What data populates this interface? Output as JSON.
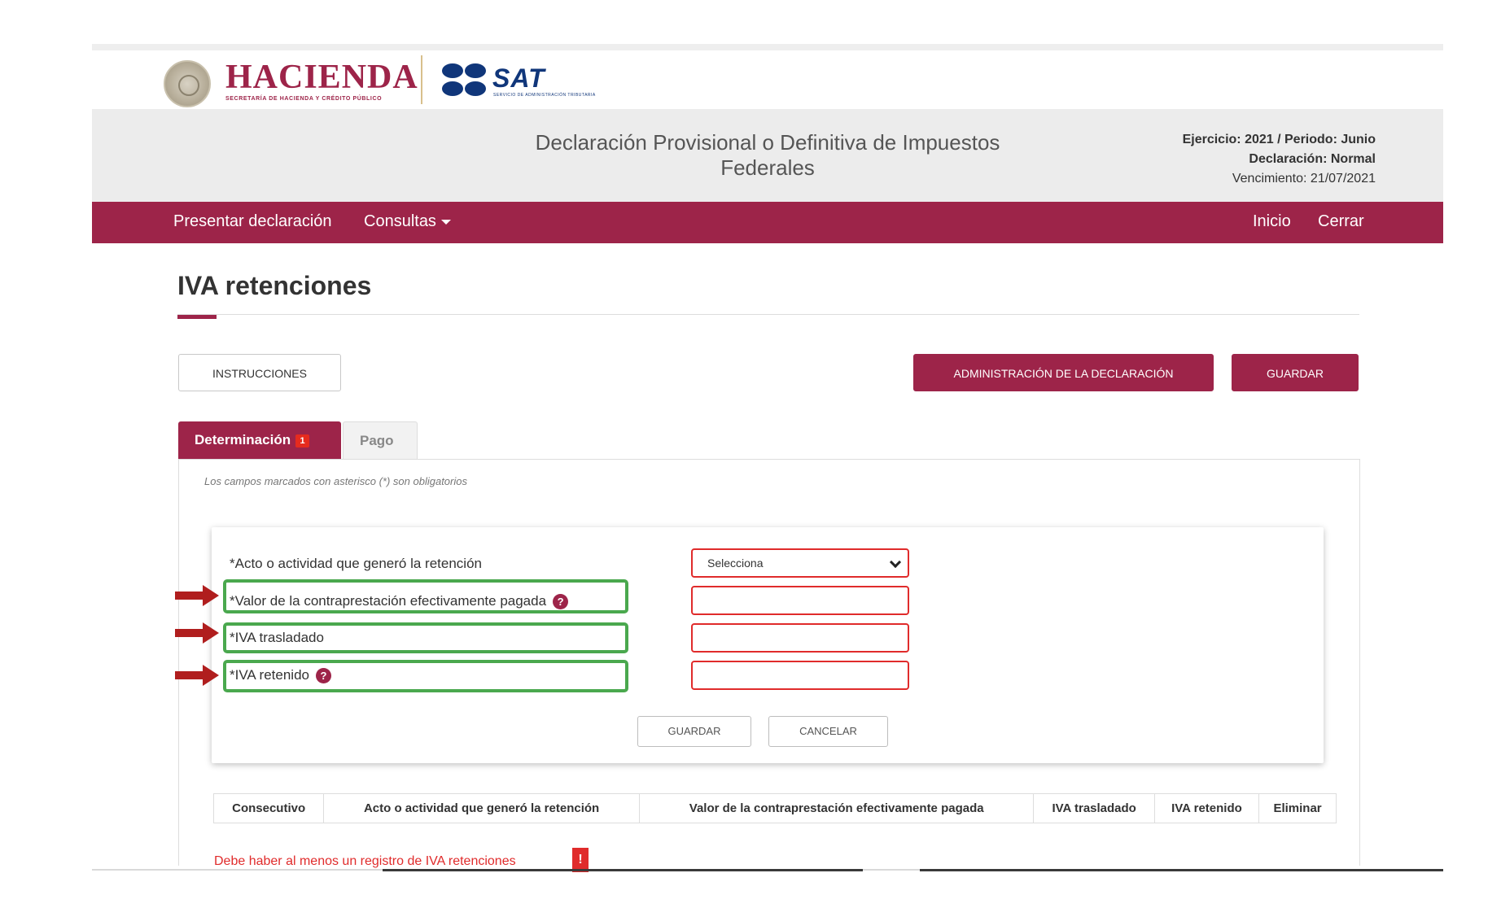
{
  "header": {
    "hacienda": "HACIENDA",
    "hacienda_sub": "SECRETARÍA DE HACIENDA Y CRÉDITO PÚBLICO",
    "sat": "SAT",
    "sat_sub": "SERVICIO DE ADMINISTRACIÓN TRIBUTARIA"
  },
  "banner": {
    "title": "Declaración Provisional o Definitiva de Impuestos Federales",
    "ejercicio": "Ejercicio: 2021 / Periodo: Junio",
    "declaracion": "Declaración: Normal",
    "vencimiento": "Vencimiento: 21/07/2021"
  },
  "nav": {
    "presentar": "Presentar declaración",
    "consultas": "Consultas",
    "inicio": "Inicio",
    "cerrar": "Cerrar"
  },
  "page": {
    "title": "IVA retenciones"
  },
  "toolbar": {
    "instrucciones": "INSTRUCCIONES",
    "administracion": "ADMINISTRACIÓN DE LA DECLARACIÓN",
    "guardar": "GUARDAR"
  },
  "tabs": {
    "determinacion": "Determinación",
    "determinacion_badge": "1",
    "pago": "Pago"
  },
  "form": {
    "required_note": "Los campos marcados con asterisco (*) son obligatorios",
    "acto_label": "*Acto o actividad que generó la retención",
    "acto_value": "Selecciona",
    "valor_label": "*Valor de la contraprestación efectivamente pagada",
    "iva_trasladado_label": "*IVA trasladado",
    "iva_retenido_label": "*IVA retenido",
    "help_icon": "?",
    "guardar": "GUARDAR",
    "cancelar": "CANCELAR"
  },
  "table": {
    "headers": [
      "Consecutivo",
      "Acto o actividad que generó la retención",
      "Valor de la contraprestación efectivamente pagada",
      "IVA trasladado",
      "IVA retenido",
      "Eliminar"
    ]
  },
  "error": {
    "message": "Debe haber al menos un registro de IVA retenciones",
    "badge": "!"
  },
  "colors": {
    "brand": "#9d2449",
    "highlight": "#4aa84e",
    "error": "#e02b2b",
    "arrow": "#b01e1e"
  }
}
